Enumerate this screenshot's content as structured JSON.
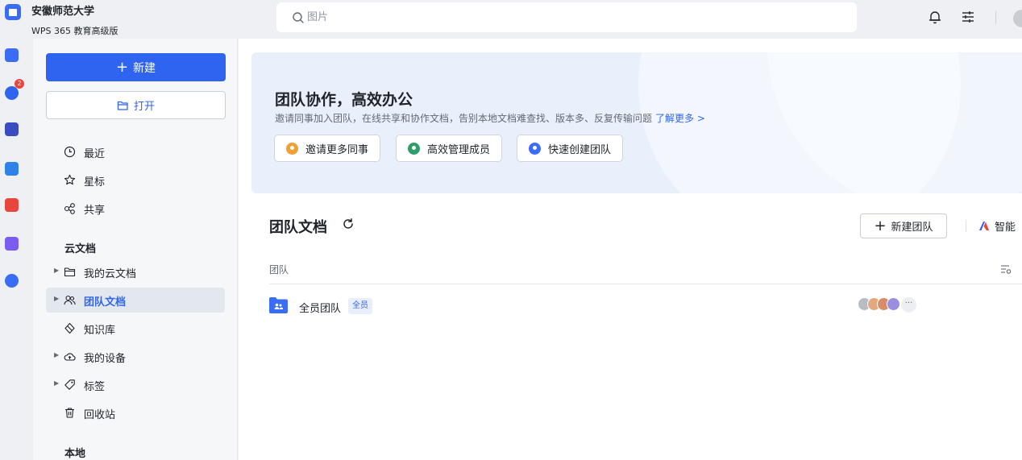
{
  "header": {
    "org_name": "安徽师范大学",
    "edition": "WPS 365 教育高级版",
    "search_placeholder": "图片"
  },
  "rail": {
    "badge_count": "2"
  },
  "sidebar": {
    "new_label": "新建",
    "open_label": "打开",
    "quick": [
      {
        "label": "最近",
        "icon": "clock-icon"
      },
      {
        "label": "星标",
        "icon": "star-icon"
      },
      {
        "label": "共享",
        "icon": "share-icon"
      }
    ],
    "cloud_title": "云文档",
    "cloud_items": [
      {
        "label": "我的云文档",
        "icon": "folder-icon",
        "expandable": true
      },
      {
        "label": "团队文档",
        "icon": "team-icon",
        "expandable": true,
        "active": true
      },
      {
        "label": "知识库",
        "icon": "knowledge-icon",
        "expandable": false
      },
      {
        "label": "我的设备",
        "icon": "cloud-device-icon",
        "expandable": true
      },
      {
        "label": "标签",
        "icon": "tag-icon",
        "expandable": true
      },
      {
        "label": "回收站",
        "icon": "trash-icon",
        "expandable": false
      }
    ],
    "local_title": "本地"
  },
  "banner": {
    "title": "团队协作，高效办公",
    "description": "邀请同事加入团队，在线共享和协作文档，告别本地文档难查找、版本多、反复传输问题",
    "link": "了解更多 >",
    "actions": [
      {
        "label": "邀请更多同事",
        "color": "#f0a030"
      },
      {
        "label": "高效管理成员",
        "color": "#2f9e6a"
      },
      {
        "label": "快速创建团队",
        "color": "#3b6cf5"
      }
    ]
  },
  "main": {
    "section_title": "团队文档",
    "new_team_label": "新建团队",
    "smart_label": "智能",
    "column_team": "团队",
    "teams": [
      {
        "name": "全员团队",
        "tag": "全员"
      }
    ],
    "avatar_more": "···"
  },
  "colors": {
    "accent": "#2e64f0",
    "sidebar_bg": "#f6f7f9",
    "banner_bg": "#eaf0fb"
  }
}
